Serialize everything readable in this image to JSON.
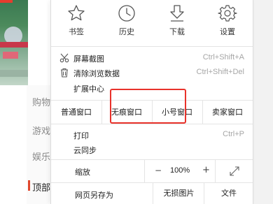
{
  "background": {
    "nav_items": [
      "购物",
      "游戏",
      "娱乐",
      "顶部"
    ],
    "active_nav": "顶部",
    "accent": "#e0472d"
  },
  "menu": {
    "quick_actions": [
      {
        "label": "书签",
        "icon": "star-icon"
      },
      {
        "label": "历史",
        "icon": "clock-icon"
      },
      {
        "label": "下载",
        "icon": "download-icon"
      },
      {
        "label": "设置",
        "icon": "gear-icon"
      }
    ],
    "tools": [
      {
        "label": "屏幕截图",
        "shortcut": "Ctrl+Shift+A",
        "icon": "scissors-icon"
      },
      {
        "label": "清除浏览数据",
        "shortcut": "Ctrl+Shift+Del",
        "icon": "trash-icon"
      },
      {
        "label": "扩展中心",
        "shortcut": "",
        "icon": ""
      }
    ],
    "window_modes": [
      "普通窗口",
      "无痕窗口",
      "小号窗口",
      "卖家窗口"
    ],
    "print": {
      "label": "打印",
      "shortcut": "Ctrl+P"
    },
    "cloud_sync": {
      "label": "云同步"
    },
    "zoom": {
      "label": "缩放",
      "minus": "−",
      "value": "100%",
      "plus": "+"
    },
    "save": {
      "label": "网页另存为",
      "options": [
        "无损图片",
        "文件"
      ]
    },
    "highlight_color": "#e8322b"
  }
}
